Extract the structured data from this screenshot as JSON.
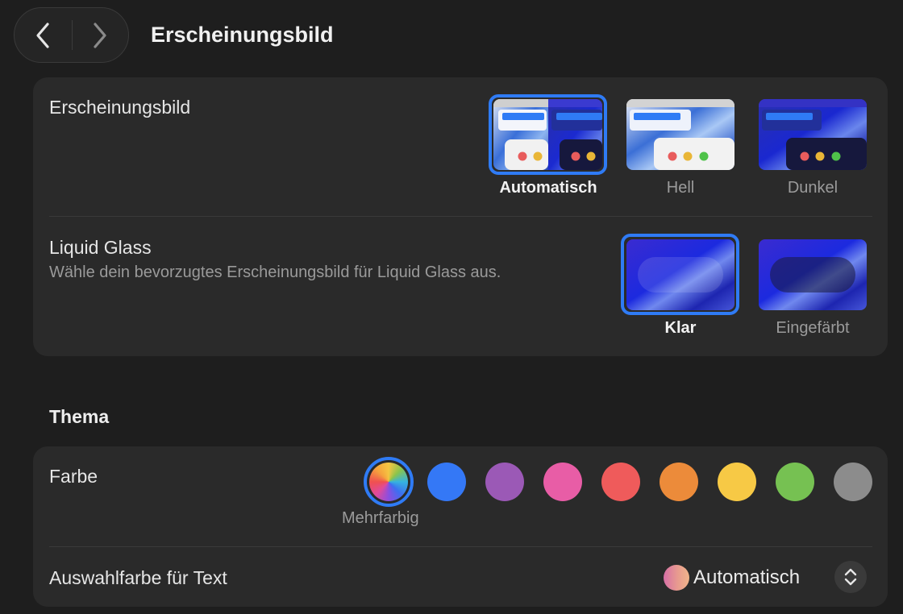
{
  "window": {
    "title": "Erscheinungsbild",
    "nav": {
      "back_icon": "chevron-left-icon",
      "forward_icon": "chevron-right-icon"
    }
  },
  "appearance": {
    "label": "Erscheinungsbild",
    "options": [
      {
        "label": "Automatisch",
        "selected": true
      },
      {
        "label": "Hell",
        "selected": false
      },
      {
        "label": "Dunkel",
        "selected": false
      }
    ]
  },
  "liquid_glass": {
    "label": "Liquid Glass",
    "description": "Wähle dein bevorzugtes Erscheinungsbild für Liquid Glass aus.",
    "options": [
      {
        "label": "Klar",
        "selected": true
      },
      {
        "label": "Eingefärbt",
        "selected": false
      }
    ]
  },
  "theme": {
    "section_title": "Thema",
    "color_label": "Farbe",
    "selected_color_label": "Mehrfarbig",
    "colors": [
      "multicolor",
      "#3478f6",
      "#9b59b6",
      "#e85da6",
      "#ef5b5b",
      "#ec8b3a",
      "#f7c945",
      "#76c152",
      "#8c8c8c"
    ],
    "highlight_label": "Auswahlfarbe für Text",
    "highlight_value": "Automatisch"
  },
  "colors": {
    "accent": "#2f7bf5",
    "background": "#1e1e1e",
    "card": "#2a2a2a"
  }
}
